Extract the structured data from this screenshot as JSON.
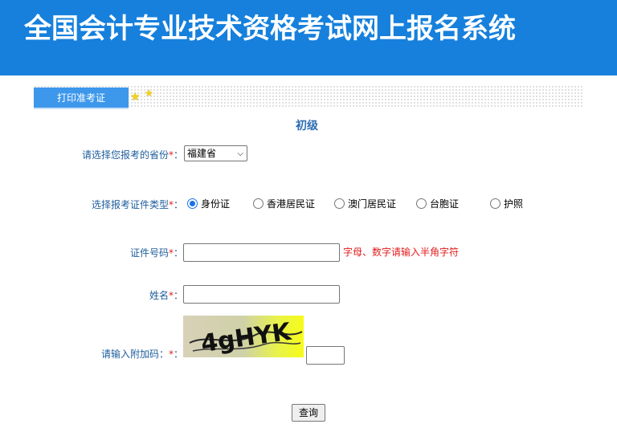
{
  "header": {
    "title": "全国会计专业技术资格考试网上报名系统"
  },
  "tab": {
    "label": "打印准考证"
  },
  "level": "初级",
  "form": {
    "province": {
      "label": "请选择您报考的省份",
      "required_mark": "*",
      "colon": "：",
      "value": "福建省"
    },
    "id_type": {
      "label": "选择报考证件类型",
      "required_mark": "*",
      "colon": "：",
      "options": [
        "身份证",
        "香港居民证",
        "澳门居民证",
        "台胞证",
        "护照"
      ],
      "selected": "身份证"
    },
    "id_number": {
      "label": "证件号码",
      "required_mark": "*",
      "colon": "：",
      "value": "",
      "hint": "字母、数字请输入半角字符"
    },
    "name": {
      "label": "姓名",
      "required_mark": "*",
      "colon": "：",
      "value": ""
    },
    "captcha": {
      "label": "请输入附加码：",
      "required_mark": "*",
      "colon": "：",
      "image_text": "4gHYK",
      "value": ""
    }
  },
  "buttons": {
    "query": "查询"
  },
  "colors": {
    "header_bg": "#1680dc",
    "tab_bg": "#3d98ec",
    "label": "#1e5d9c",
    "required": "#e21c1c"
  }
}
